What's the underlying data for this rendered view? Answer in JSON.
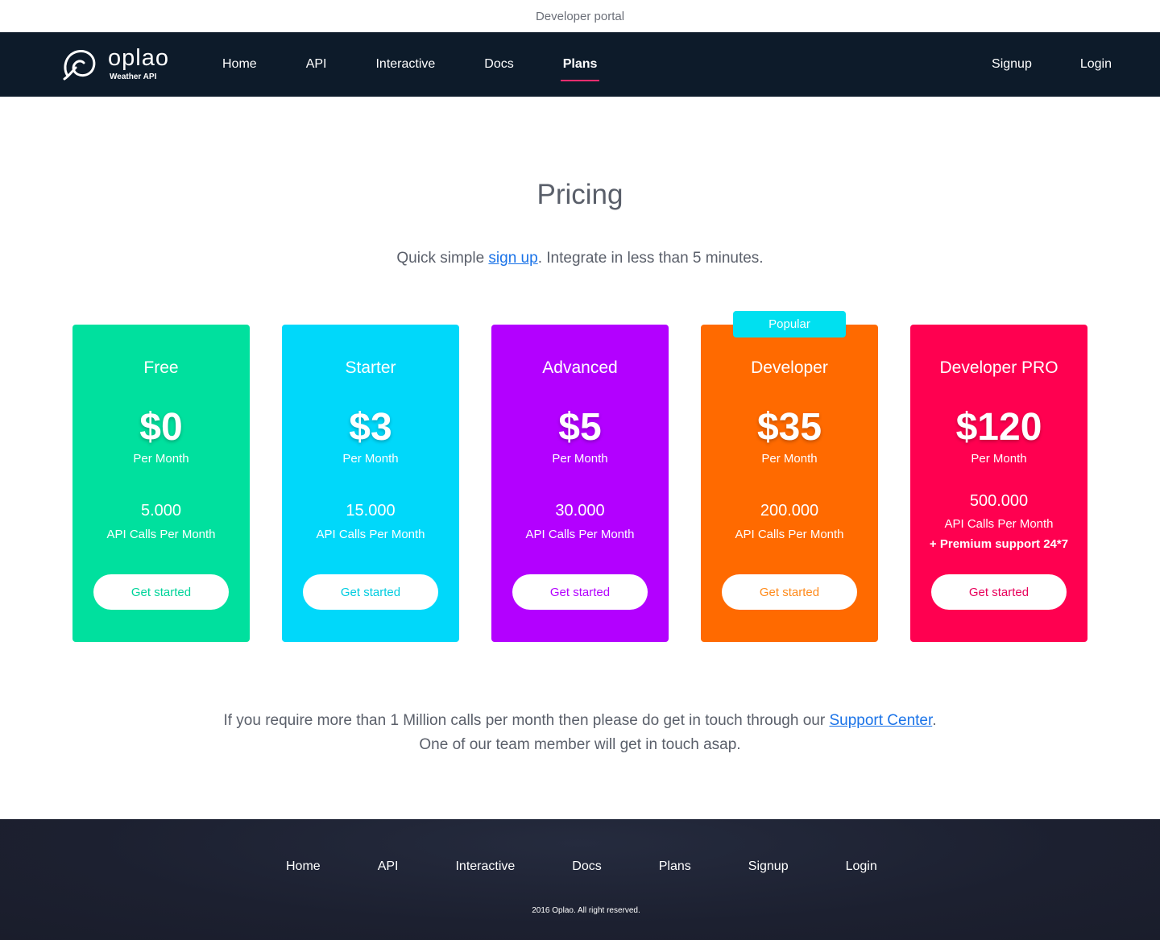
{
  "topbar": {
    "title": "Developer portal"
  },
  "brand": {
    "name": "oplao",
    "subtitle": "Weather API"
  },
  "nav": {
    "items": [
      "Home",
      "API",
      "Interactive",
      "Docs",
      "Plans"
    ],
    "active": "Plans",
    "right": [
      "Signup",
      "Login"
    ]
  },
  "page": {
    "title": "Pricing",
    "subtitle_before": "Quick simple ",
    "subtitle_link": "sign up",
    "subtitle_after": ". Integrate in less than 5 minutes."
  },
  "plans": [
    {
      "name": "Free",
      "price": "$0",
      "period": "Per Month",
      "calls": "5.000",
      "calls_label": "API Calls Per Month",
      "button": "Get started",
      "color": "#00e09e",
      "button_color": "#00d49a"
    },
    {
      "name": "Starter",
      "price": "$3",
      "period": "Per Month",
      "calls": "15.000",
      "calls_label": "API Calls Per Month",
      "button": "Get started",
      "color": "#00d8fa",
      "button_color": "#00cce0"
    },
    {
      "name": "Advanced",
      "price": "$5",
      "period": "Per Month",
      "calls": "30.000",
      "calls_label": "API Calls Per Month",
      "button": "Get started",
      "color": "#b300ff",
      "button_color": "#b300ff"
    },
    {
      "name": "Developer",
      "price": "$35",
      "period": "Per Month",
      "calls": "200.000",
      "calls_label": "API Calls Per Month",
      "button": "Get started",
      "color": "#ff6a00",
      "button_color": "#ff8a1a",
      "badge": "Popular",
      "badge_color": "#00e0f0"
    },
    {
      "name": "Developer PRO",
      "price": "$120",
      "period": "Per Month",
      "calls": "500.000",
      "calls_label": "API Calls Per Month",
      "extra": "+ Premium support 24*7",
      "button": "Get started",
      "color": "#ff0050",
      "button_color": "#e8005a"
    }
  ],
  "contact": {
    "line1_before": "If you require more than 1 Million calls per month then please do get in touch through our ",
    "line1_link": "Support Center",
    "line1_after": ".",
    "line2": "One of our team member will get in touch asap."
  },
  "footer": {
    "links": [
      "Home",
      "API",
      "Interactive",
      "Docs",
      "Plans",
      "Signup",
      "Login"
    ],
    "copyright": "2016 Oplao. All right reserved."
  }
}
